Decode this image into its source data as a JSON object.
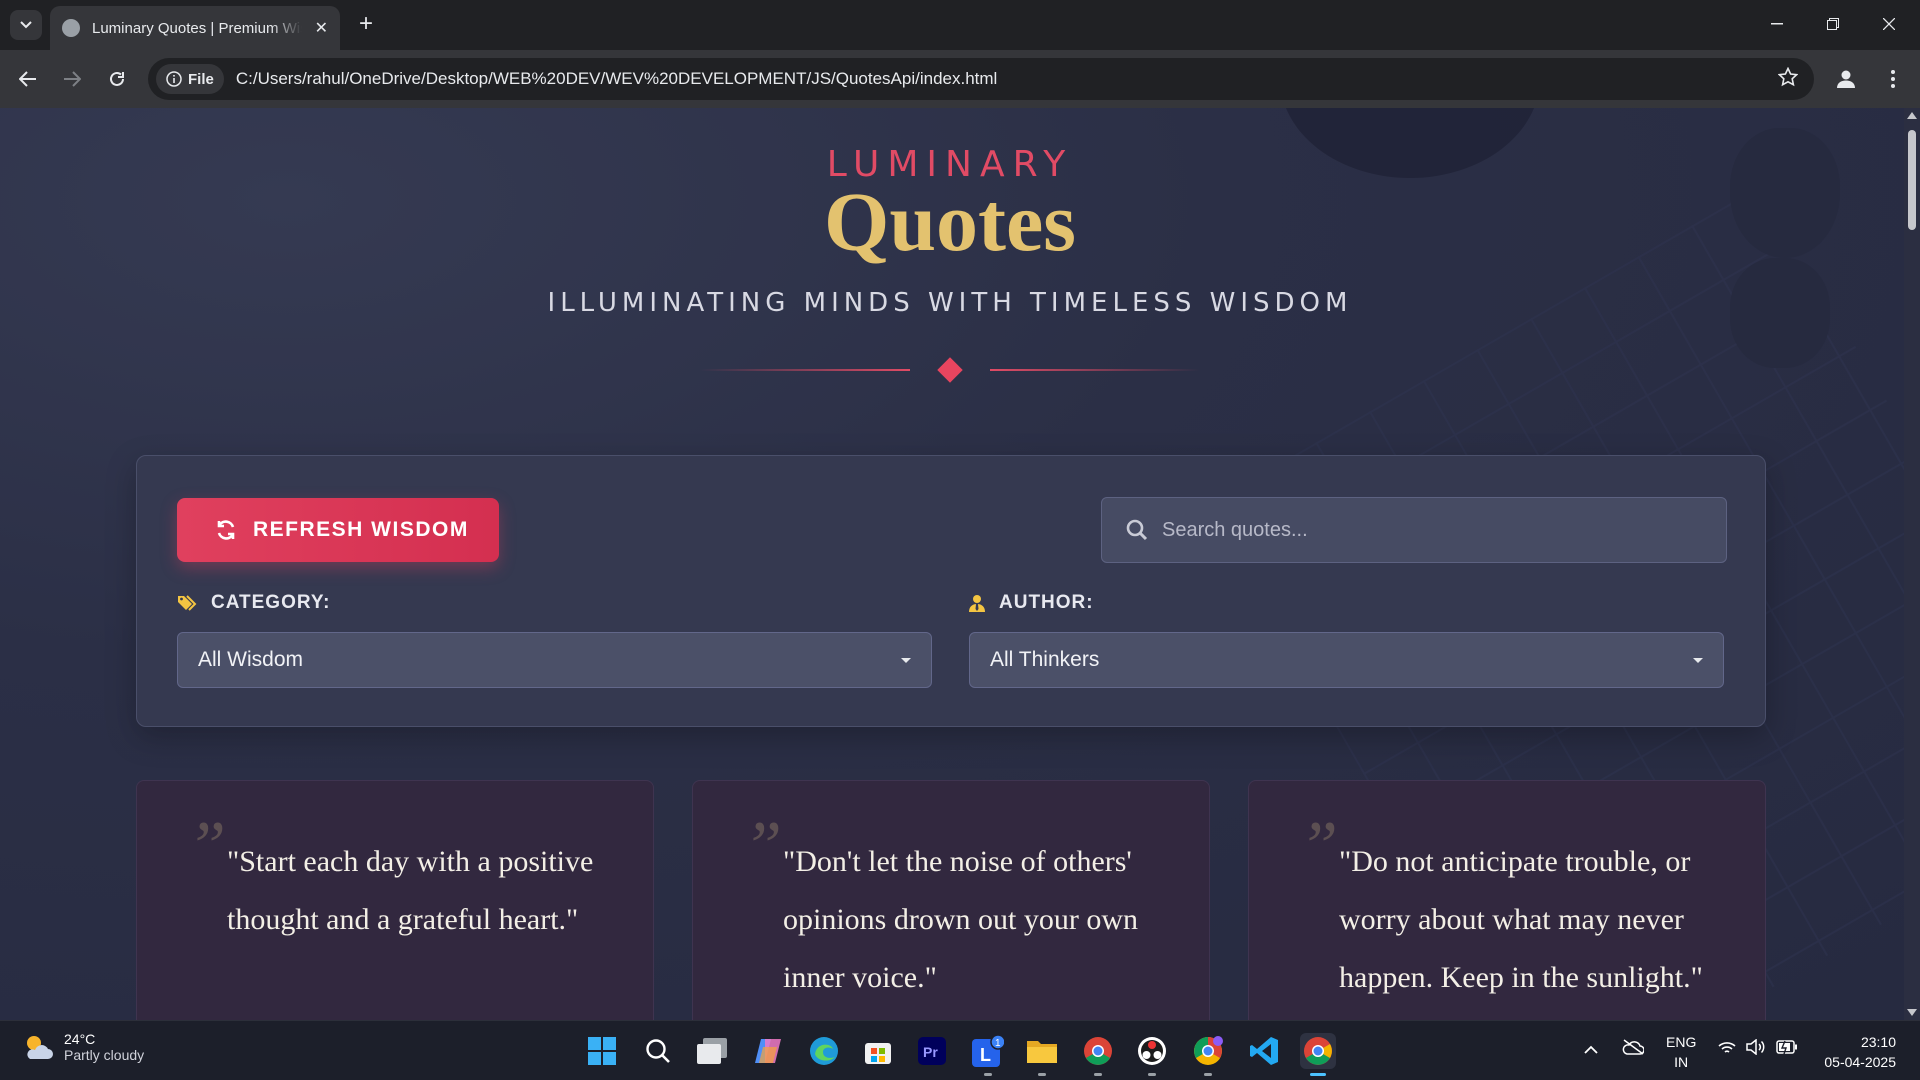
{
  "browser": {
    "tab_title": "Luminary Quotes | Premium Wisdom",
    "url_chip": "File",
    "url": "C:/Users/rahul/OneDrive/Desktop/WEB%20DEV/WEV%20DEVELOPMENT/JS/QuotesApi/index.html"
  },
  "hero": {
    "brand_small": "LUMINARY",
    "brand_big": "Quotes",
    "tagline": "ILLUMINATING MINDS WITH TIMELESS WISDOM"
  },
  "controls": {
    "refresh_label": "REFRESH WISDOM",
    "search_placeholder": "Search quotes...",
    "category_label": "CATEGORY:",
    "category_value": "All Wisdom",
    "author_label": "AUTHOR:",
    "author_value": "All Thinkers"
  },
  "quotes": [
    {
      "mark": "”",
      "text": "\"Start each day with a positive thought and a grateful heart.\""
    },
    {
      "mark": "”",
      "text": "\"Don't let the noise of others' opinions drown out your own inner voice.\""
    },
    {
      "mark": "”",
      "text": "\"Do not anticipate trouble, or worry about what may never happen. Keep in the sunlight.\""
    }
  ],
  "taskbar": {
    "weather_temp": "24°C",
    "weather_desc": "Partly cloudy",
    "lang_top": "ENG",
    "lang_bottom": "IN",
    "time": "23:10",
    "date": "05-04-2025",
    "notification_badge": "1"
  },
  "colors": {
    "accent_red": "#e0405e",
    "gold": "#e3c26f",
    "page_bg": "#2b2f46"
  }
}
